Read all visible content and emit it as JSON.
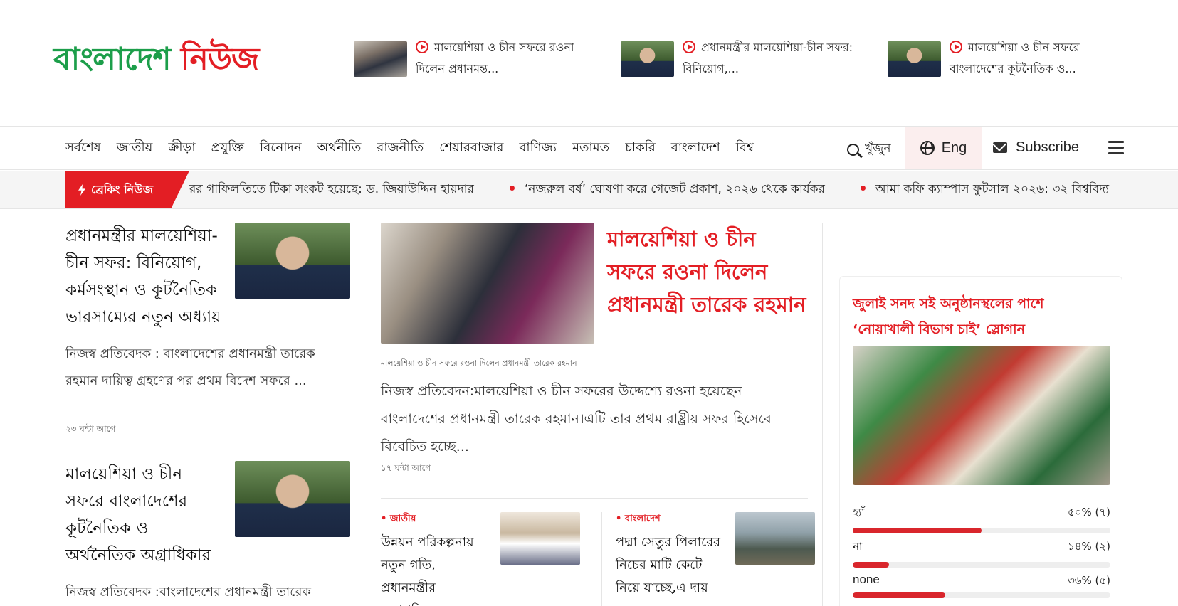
{
  "header": {
    "logo_part1": "বাংলাদেশ",
    "logo_part2": "নিউজ",
    "top_news": [
      {
        "title": "মালয়েশিয়া ও চীন সফরে রওনা দিলেন প্রধানমন্ত..."
      },
      {
        "title": "প্রধানমন্ত্রীর মালয়েশিয়া-চীন সফর: বিনিয়োগ,..."
      },
      {
        "title": "মালয়েশিয়া ও চীন সফরে বাংলাদেশের কূটনৈতিক ও..."
      }
    ]
  },
  "nav": {
    "items": [
      "সর্বশেষ",
      "জাতীয়",
      "ক্রীড়া",
      "প্রযুক্তি",
      "বিনোদন",
      "অর্থনীতি",
      "রাজনীতি",
      "শেয়ারবাজার",
      "বাণিজ্য",
      "মতামত",
      "চাকরি",
      "বাংলাদেশ",
      "বিশ্ব"
    ],
    "search_label": "খুঁজুন",
    "lang_label": "Eng",
    "subscribe_label": "Subscribe"
  },
  "breaking": {
    "label": "ব্রেকিং নিউজ",
    "items": [
      "রর গাফিলতিতে টিকা সংকট হয়েছে: ড. জিয়াউদ্দিন হায়দার",
      "‘নজরুল বর্ষ’ ঘোষণা করে গেজেট প্রকাশ, ২০২৬ থেকে কার্যকর",
      "আমা কফি ক্যাম্পাস ফুটসাল ২০২৬: ৩২ বিশ্ববিদ্য"
    ]
  },
  "left_stories": [
    {
      "title": "প্রধানমন্ত্রীর মালয়েশিয়া-চীন সফর: বিনিয়োগ, কর্মসংস্থান ও কূটনৈতিক ভারসাম্যের নতুন অধ্যায়",
      "excerpt": "নিজস্ব প্রতিবেদক : বাংলাদেশের প্রধানমন্ত্রী তারেক রহমান দায়িত্ব গ্রহণের পর প্রথম বিদেশ সফরে ...",
      "time": "২৩ ঘন্টা আগে"
    },
    {
      "title": "মালয়েশিয়া ও চীন সফরে বাংলাদেশের কূটনৈতিক ও অর্থনৈতিক অগ্রাধিকার",
      "excerpt": "নিজস্ব প্রতিবেদক :বাংলাদেশের প্রধানমন্ত্রী তারেক রহমানের আসন্ন মালয়েশিয়া ও চীন সফরকে কেন্দ্র করে"
    }
  ],
  "lead": {
    "title": "মালয়েশিয়া ও চীন সফরে রওনা দিলেন প্রধানমন্ত্রী তারেক রহমান",
    "caption": "মালয়েশিয়া ও চীন সফরে রওনা দিলেন প্রধানমন্ত্রী তারেক রহমান",
    "excerpt": "নিজস্ব প্রতিবেদন:মালয়েশিয়া ও চীন সফরের উদ্দেশ্যে রওনা হয়েছেন বাংলাদেশের প্রধানমন্ত্রী তারেক রহমান।এটি তার প্রথম রাষ্ট্রীয় সফর হিসেবে বিবেচিত হচ্ছে...",
    "time": "১৭ ঘন্টা আগে"
  },
  "small_stories": [
    {
      "category": "জাতীয়",
      "title": "উন্নয়ন পরিকল্পনায় নতুন গতি, প্রধানমন্ত্রীর সভাপতিত্বে একনেক"
    },
    {
      "category": "বাংলাদেশ",
      "title": "পদ্মা সেতুর পিলারের নিচের মাটি কেটে নিয়ে যাচ্ছে,এ দায়"
    }
  ],
  "poll": {
    "question": "জুলাই সনদ সই অনুষ্ঠানস্থলের পাশে ‘নোয়াখালী বিভাগ চাই’ স্লোগান",
    "options": [
      {
        "label": "হ্যাঁ",
        "result": "৫০% (৭)",
        "fraction": 0.5
      },
      {
        "label": "না",
        "result": "১৪% (২)",
        "fraction": 0.14
      },
      {
        "label": "none",
        "result": "৩৬% (৫)",
        "fraction": 0.36
      }
    ],
    "accent_color": "#d9262c"
  },
  "colors": {
    "brand_green": "#1c9e4a",
    "brand_red": "#e31e24"
  }
}
